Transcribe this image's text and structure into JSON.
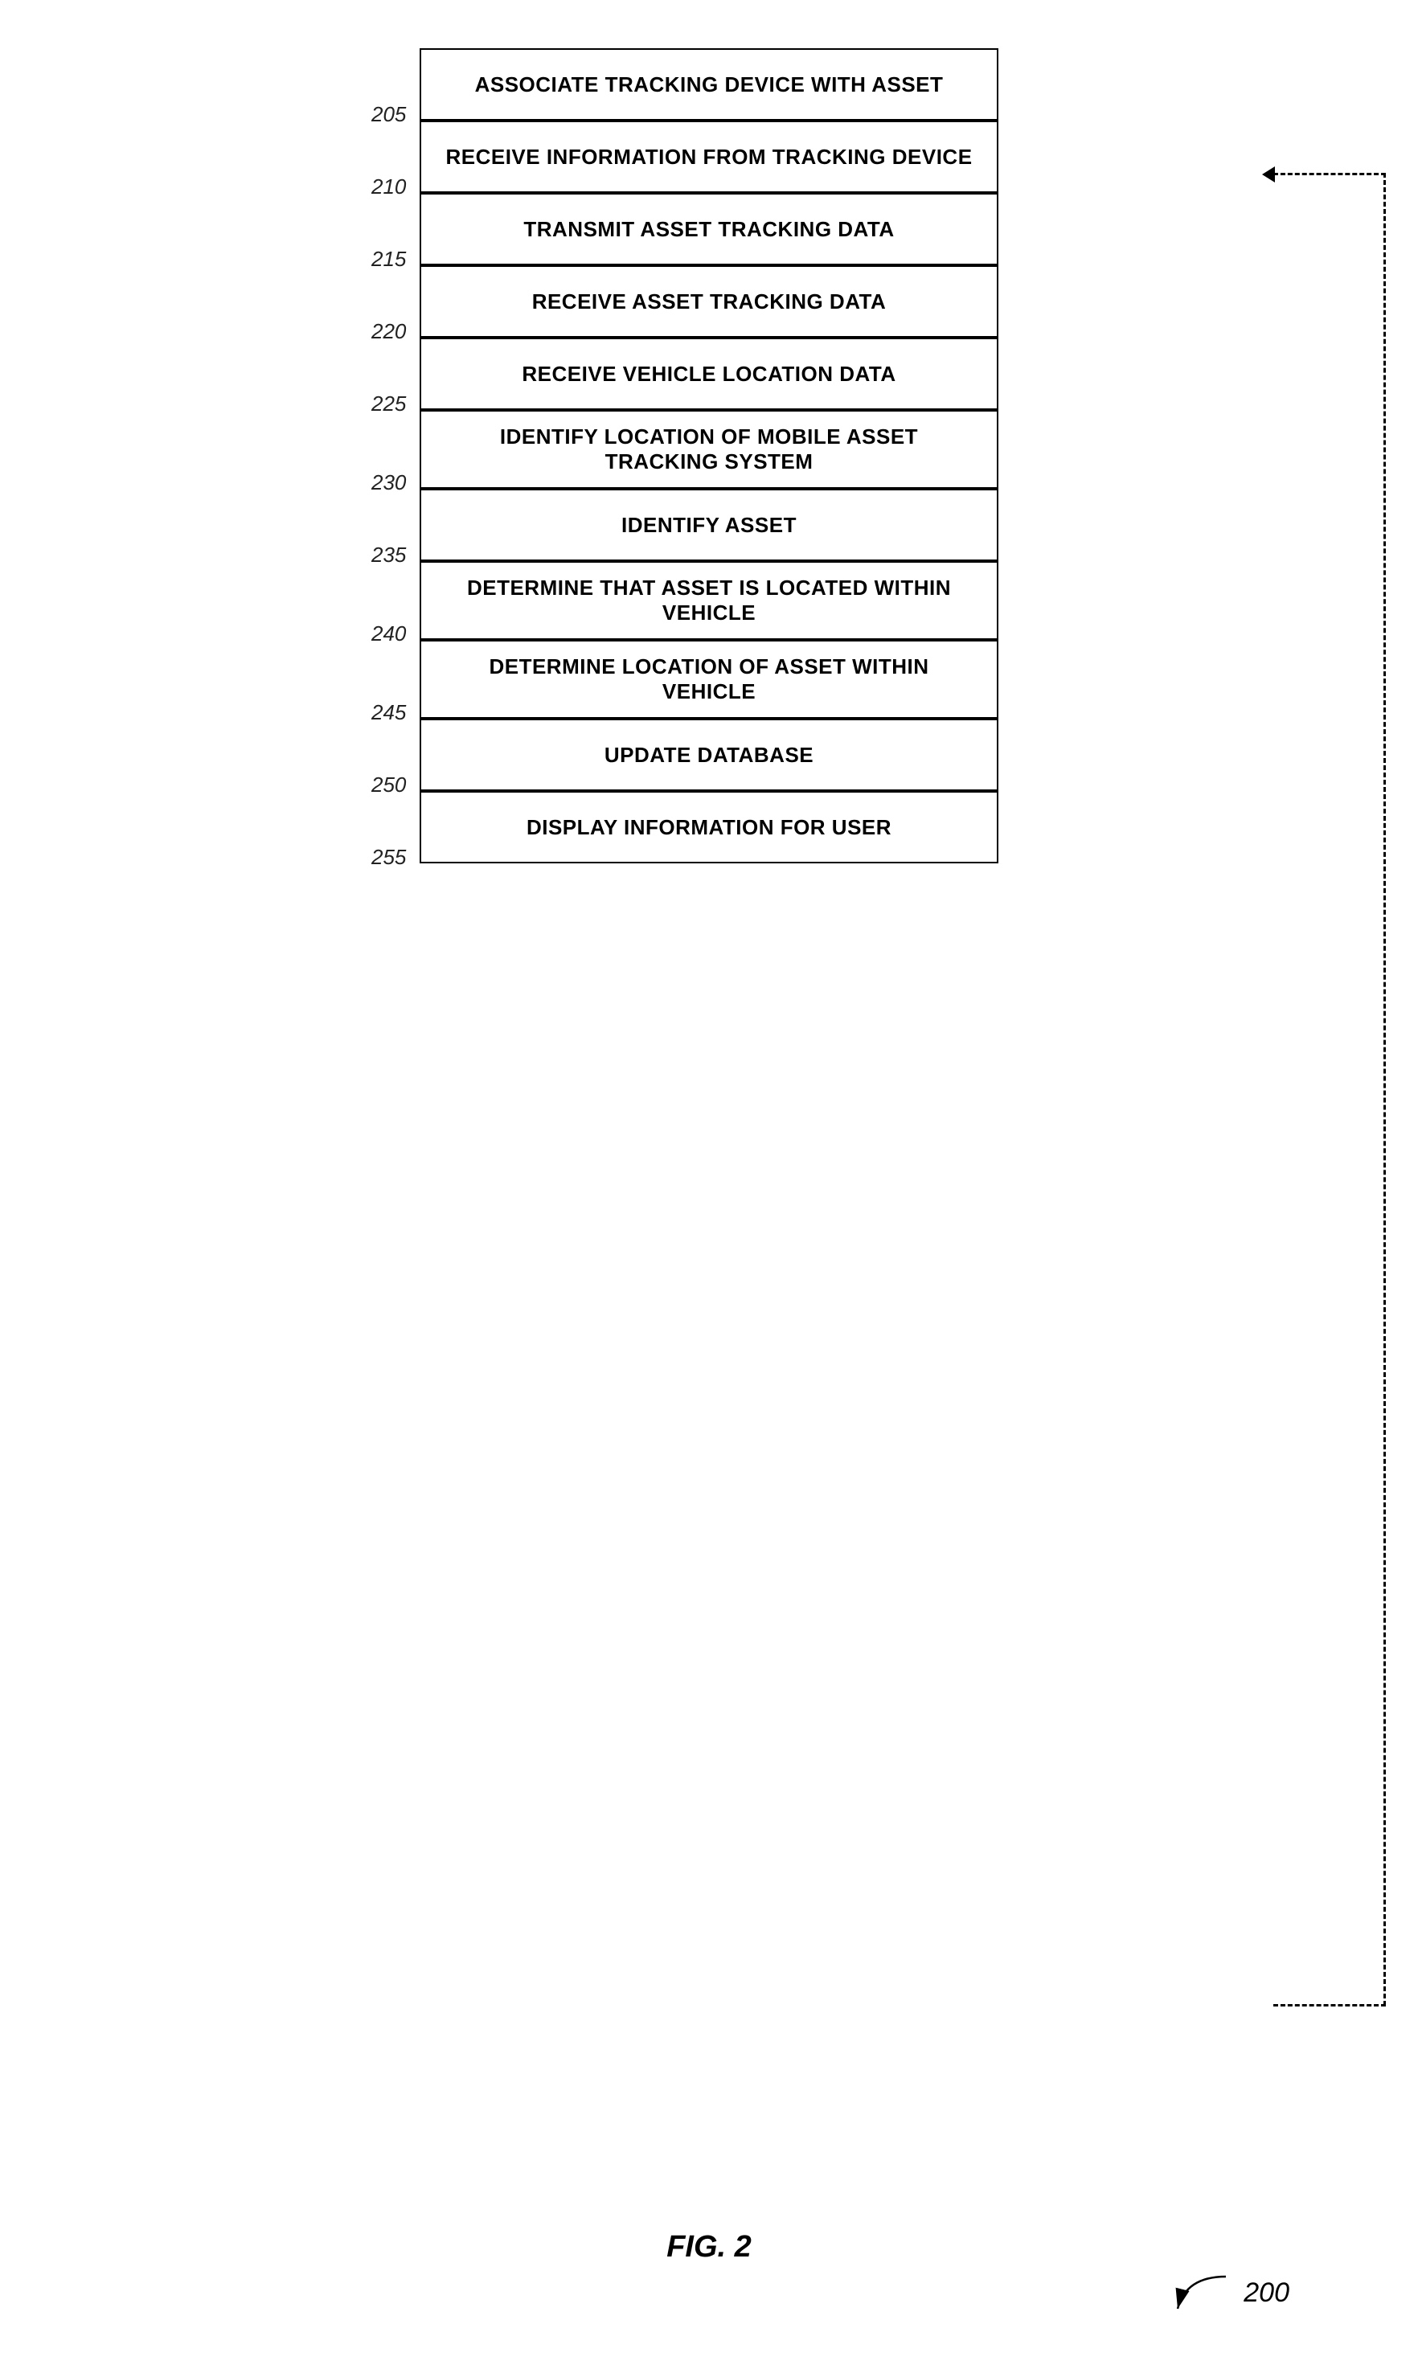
{
  "diagram": {
    "title": "FIG. 2",
    "ref_number": "200",
    "steps": [
      {
        "id": "205",
        "label": "205",
        "text": "ASSOCIATE TRACKING DEVICE\nWITH ASSET"
      },
      {
        "id": "210",
        "label": "210",
        "text": "RECEIVE INFORMATION FROM\nTRACKING DEVICE"
      },
      {
        "id": "215",
        "label": "215",
        "text": "TRANSMIT ASSET TRACKING DATA"
      },
      {
        "id": "220",
        "label": "220",
        "text": "RECEIVE ASSET TRACKING DATA"
      },
      {
        "id": "225",
        "label": "225",
        "text": "RECEIVE VEHICLE LOCATION DATA"
      },
      {
        "id": "230",
        "label": "230",
        "text": "IDENTIFY LOCATION OF MOBILE\nASSET TRACKING SYSTEM"
      },
      {
        "id": "235",
        "label": "235",
        "text": "IDENTIFY ASSET"
      },
      {
        "id": "240",
        "label": "240",
        "text": "DETERMINE THAT ASSET IS\nLOCATED WITHIN VEHICLE"
      },
      {
        "id": "245",
        "label": "245",
        "text": "DETERMINE LOCATION OF ASSET\nWITHIN VEHICLE"
      },
      {
        "id": "250",
        "label": "250",
        "text": "UPDATE DATABASE"
      },
      {
        "id": "255",
        "label": "255",
        "text": "DISPLAY INFORMATION FOR USER"
      }
    ]
  }
}
